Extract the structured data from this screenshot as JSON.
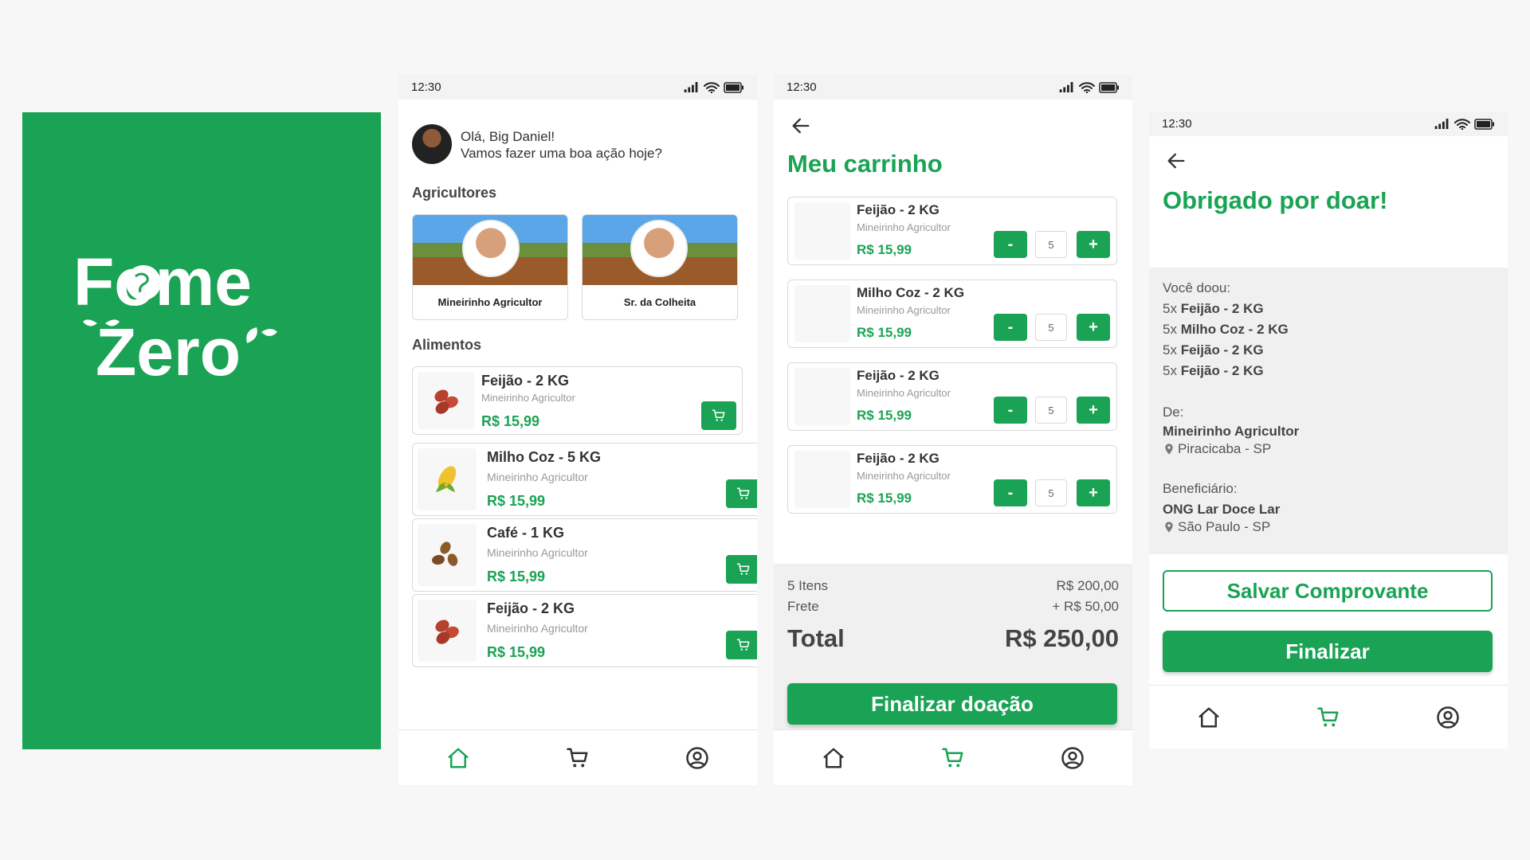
{
  "brand": {
    "line1": "Fome",
    "line2": "Zero",
    "color": "#1aa354"
  },
  "status": {
    "time": "12:30"
  },
  "icons": {
    "signal": "signal-icon",
    "wifi": "wifi-icon",
    "battery": "battery-icon",
    "home": "home-icon",
    "cart": "cart-icon",
    "profile": "profile-icon",
    "back": "arrow-left-icon",
    "add_to_cart": "add-cart-icon",
    "location": "location-pin-icon"
  },
  "home": {
    "greeting": "Olá, Big Daniel!",
    "subgreeting": "Vamos fazer uma boa ação hoje?",
    "farmers_title": "Agricultores",
    "farmers": [
      {
        "name": "Mineirinho Agricultor"
      },
      {
        "name": "Sr. da Colheita"
      }
    ],
    "foods_title": "Alimentos",
    "foods": [
      {
        "name": "Feijão - 2 KG",
        "farmer": "Mineirinho Agricultor",
        "price": "R$ 15,99",
        "icon": "beans"
      },
      {
        "name": "Milho Coz - 5 KG",
        "farmer": "Mineirinho Agricultor",
        "price": "R$ 15,99",
        "icon": "corn"
      },
      {
        "name": "Café - 1 KG",
        "farmer": "Mineirinho Agricultor",
        "price": "R$ 15,99",
        "icon": "coffee"
      },
      {
        "name": "Feijão - 2 KG",
        "farmer": "Mineirinho Agricultor",
        "price": "R$ 15,99",
        "icon": "beans"
      }
    ]
  },
  "cart": {
    "title": "Meu carrinho",
    "items": [
      {
        "name": "Feijão - 2 KG",
        "farmer": "Mineirinho Agricultor",
        "price": "R$ 15,99",
        "qty": "5"
      },
      {
        "name": "Milho Coz - 2 KG",
        "farmer": "Mineirinho Agricultor",
        "price": "R$ 15,99",
        "qty": "5"
      },
      {
        "name": "Feijão - 2 KG",
        "farmer": "Mineirinho Agricultor",
        "price": "R$ 15,99",
        "qty": "5"
      },
      {
        "name": "Feijão - 2 KG",
        "farmer": "Mineirinho Agricultor",
        "price": "R$ 15,99",
        "qty": "5"
      }
    ],
    "minus_label": "-",
    "plus_label": "+",
    "items_label": "5 Itens",
    "items_value": "R$ 200,00",
    "shipping_label": "Frete",
    "shipping_value": "+ R$ 50,00",
    "total_label": "Total",
    "total_value": "R$ 250,00",
    "checkout_label": "Finalizar doação"
  },
  "thanks": {
    "title": "Obrigado por doar!",
    "donated_label": "Você doou:",
    "donated": [
      {
        "qty": "5x",
        "name": "Feijão - 2 KG"
      },
      {
        "qty": "5x",
        "name": "Milho Coz - 2 KG"
      },
      {
        "qty": "5x",
        "name": "Feijão - 2 KG"
      },
      {
        "qty": "5x",
        "name": "Feijão - 2 KG"
      }
    ],
    "from_label": "De:",
    "from_name": "Mineirinho Agricultor",
    "from_city": "Piracicaba - SP",
    "beneficiary_label": "Beneficiário:",
    "beneficiary_name": "ONG Lar Doce Lar",
    "beneficiary_city": "São Paulo - SP",
    "save_label": "Salvar Comprovante",
    "finish_label": "Finalizar"
  }
}
